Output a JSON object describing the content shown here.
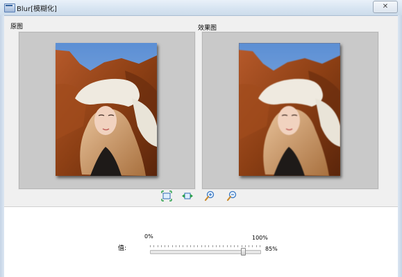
{
  "window": {
    "title": "Blur[模糊化]",
    "close_label": "✕"
  },
  "panels": {
    "original_label": "原图",
    "effect_label": "效果图"
  },
  "toolbar": {
    "buttons": [
      {
        "name": "fit-window-icon"
      },
      {
        "name": "actual-size-icon"
      },
      {
        "name": "zoom-in-icon"
      },
      {
        "name": "zoom-out-icon"
      }
    ]
  },
  "controls": {
    "value_label": "值:",
    "min_label": "0%",
    "max_label": "100%",
    "current_value_label": "85%",
    "current_value": 0.85
  },
  "colors": {
    "panel_bg": "#c9c9c9",
    "sky": "#6c9ad6",
    "rock": "#8c3f14"
  }
}
